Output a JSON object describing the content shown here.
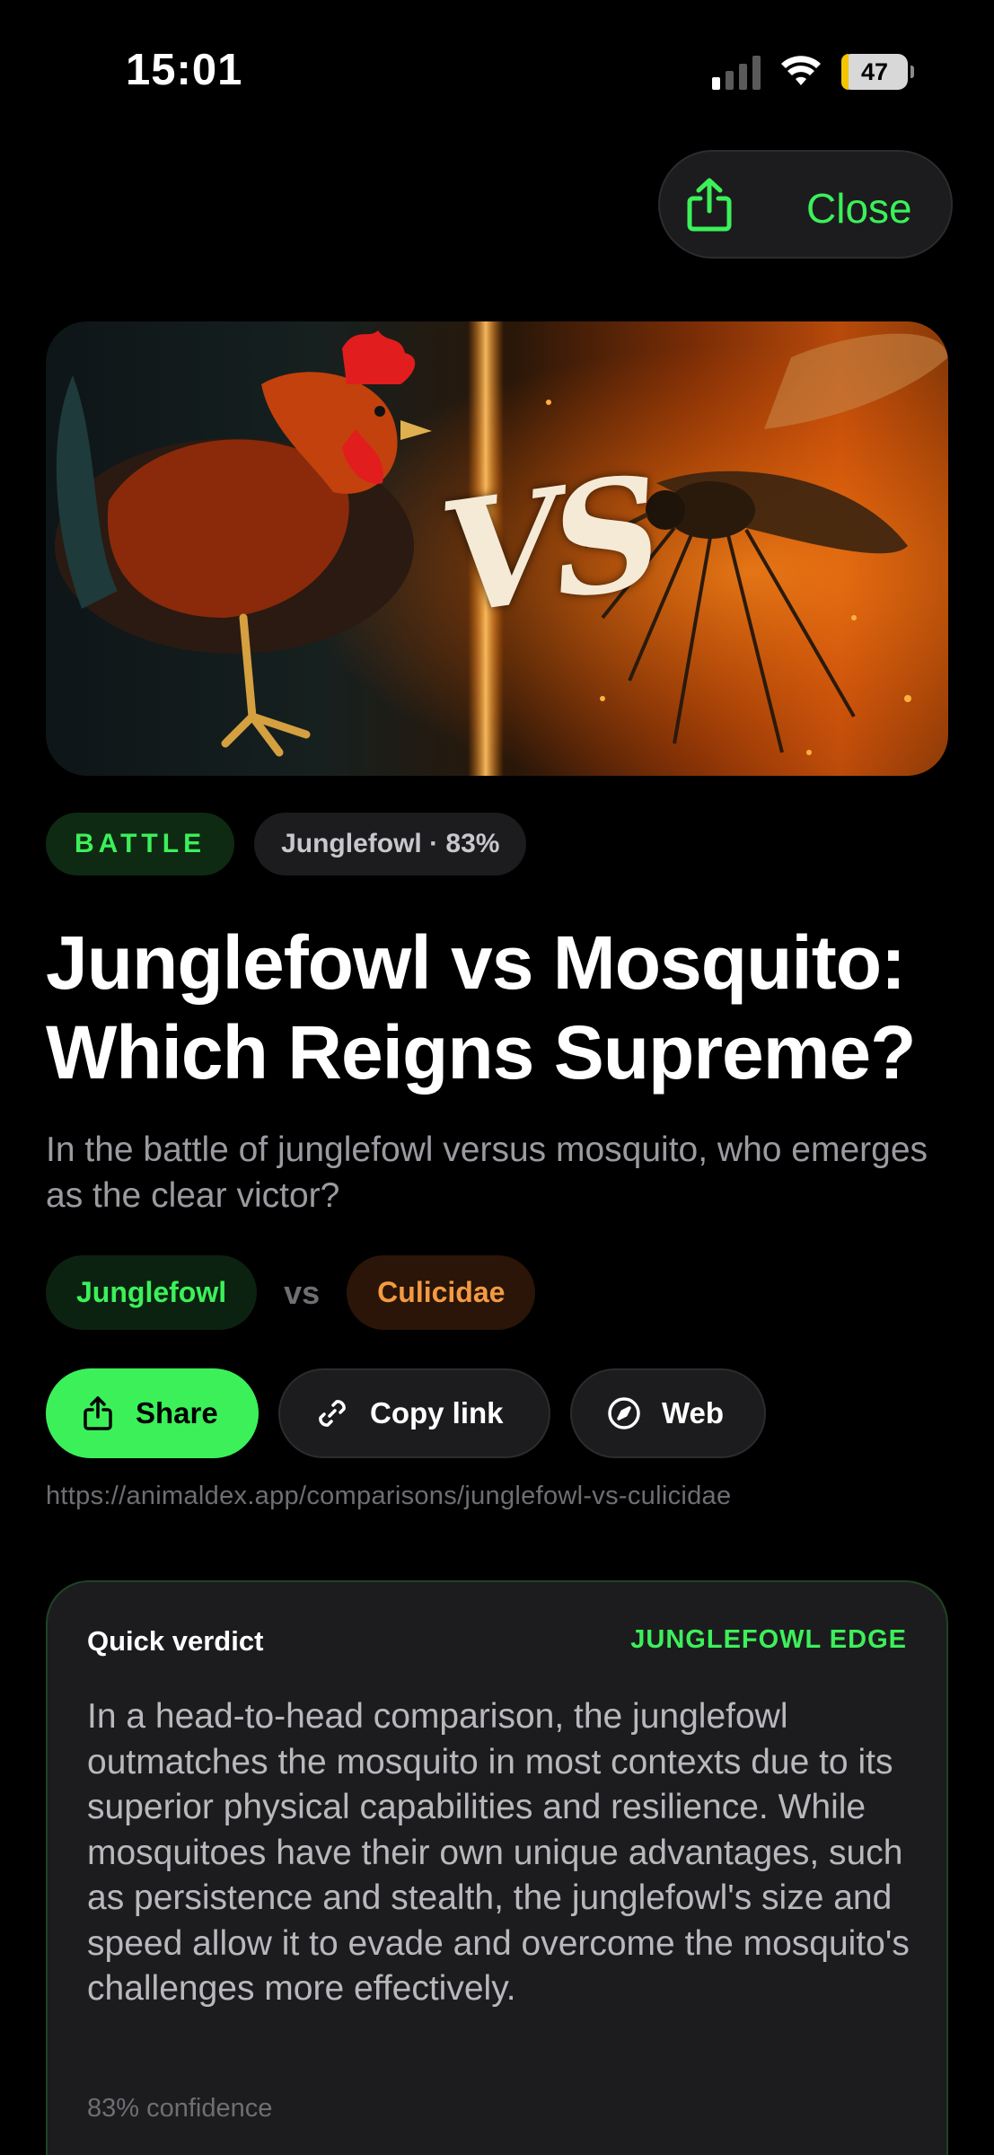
{
  "status_bar": {
    "time": "15:01",
    "battery": "47"
  },
  "header": {
    "close_label": "Close"
  },
  "hero": {
    "vs_text": "VS"
  },
  "tags": {
    "category": "BATTLE",
    "stat": "Junglefowl · 83%"
  },
  "article": {
    "title": "Junglefowl vs Mosquito: Which Reigns Supreme?",
    "subtitle": "In the battle of junglefowl versus mosquito, who emerges as the clear victor?"
  },
  "versus": {
    "left": "Junglefowl",
    "separator": "vs",
    "right": "Culicidae"
  },
  "actions": {
    "share_label": "Share",
    "copy_label": "Copy link",
    "web_label": "Web"
  },
  "url": "https://animaldex.app/comparisons/junglefowl-vs-culicidae",
  "verdict": {
    "label": "Quick verdict",
    "edge": "JUNGLEFOWL EDGE",
    "text": "In a head-to-head comparison, the junglefowl outmatches the mosquito in most contexts due to its superior physical capabilities and resilience. While mosquitoes have their own unique advantages, such as persistence and stealth, the junglefowl's size and speed allow it to evade and overcome the mosquito's challenges more effectively.",
    "confidence": "83% confidence"
  },
  "colors": {
    "accent": "#3cf05a",
    "secondary": "#f39a42",
    "background": "#000000",
    "card": "#1c1c1e"
  },
  "icons": {
    "top_share": "share-icon",
    "copy": "link-icon",
    "web": "compass-icon"
  }
}
